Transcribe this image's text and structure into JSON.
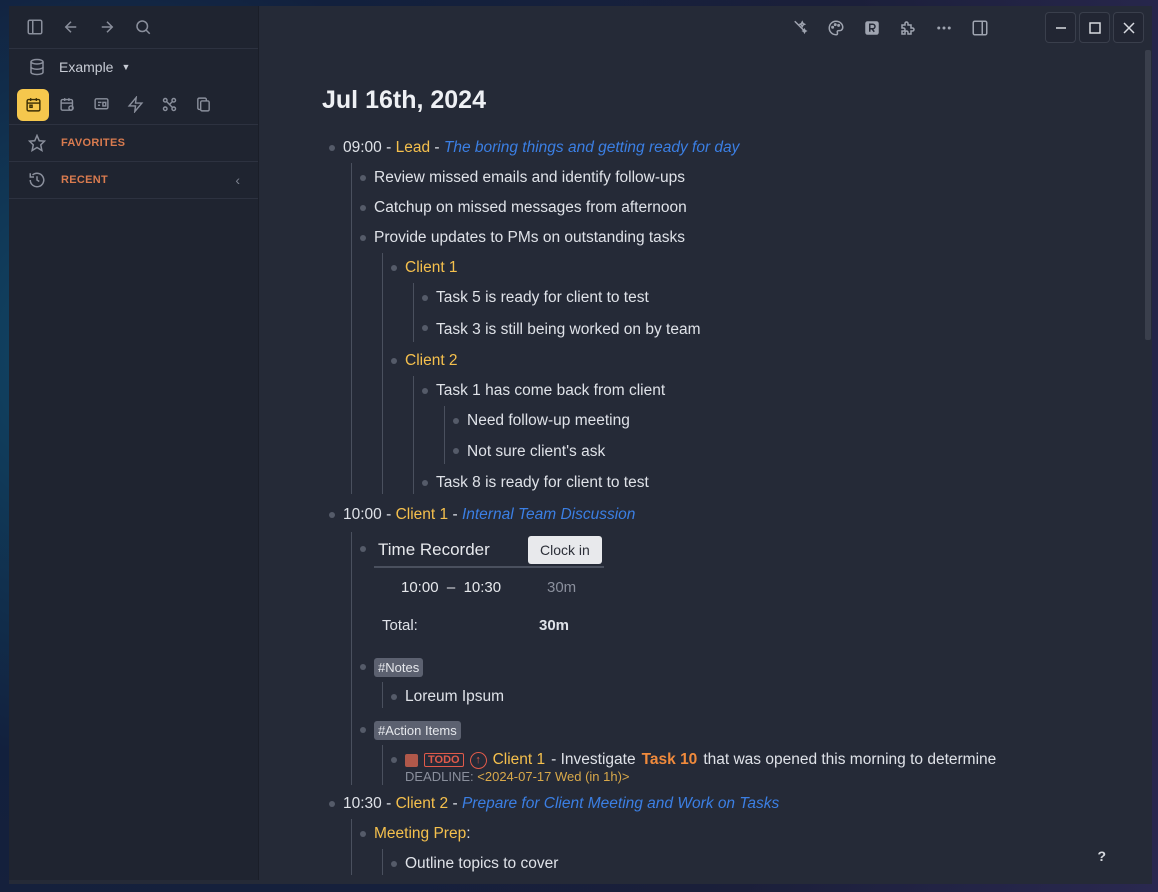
{
  "sidebar": {
    "graph_name": "Example",
    "favorites_label": "FAVORITES",
    "recent_label": "RECENT",
    "recent_chevron": "‹"
  },
  "page": {
    "title": "Jul 16th, 2024",
    "sep": "-",
    "b1": {
      "time": "09:00",
      "who": "Lead",
      "desc": "The boring things and getting ready for day"
    },
    "b1_children": [
      "Review missed emails and identify follow-ups",
      "Catchup on missed messages from afternoon",
      "Provide updates to PMs on outstanding tasks"
    ],
    "client1_label": "Client 1",
    "client1_tasks": [
      "Task 5 is ready for client to test",
      "Task 3 is still being worked on by team"
    ],
    "client2_label": "Client 2",
    "client2_task1": "Task 1 has come back from client",
    "client2_task1_children": [
      "Need follow-up meeting",
      "Not sure client's ask"
    ],
    "client2_task2": "Task 8 is ready for client to test",
    "b2": {
      "time": "10:00",
      "who": "Client 1",
      "desc": "Internal Team Discussion"
    },
    "timer": {
      "title": "Time Recorder",
      "clock_in": "Clock in",
      "start": "10:00",
      "dash": "–",
      "end": "10:30",
      "duration": "30m",
      "total_label": "Total:",
      "total_value": "30m"
    },
    "notes_tag": "#Notes",
    "notes_child": "Loreum Ipsum",
    "action_tag": "#Action Items",
    "todo": {
      "badge": "TODO",
      "client": "Client 1",
      "text_a": "- Investigate",
      "task": "Task 10",
      "text_b": "that was opened this morning to determine",
      "deadline_label": "DEADLINE:",
      "deadline_value": "<2024-07-17 Wed (in 1h)>"
    },
    "b3": {
      "time": "10:30",
      "who": "Client 2",
      "desc": "Prepare for Client Meeting and Work on Tasks"
    },
    "prep_label": "Meeting Prep",
    "prep_colon": ":",
    "prep_child": "Outline topics to cover"
  },
  "help_label": "?",
  "colors": {
    "accent": "#f5c74d",
    "link": "#3b7fe4",
    "tag_orange": "#f08a3c",
    "todo_red": "#e05a4a"
  }
}
